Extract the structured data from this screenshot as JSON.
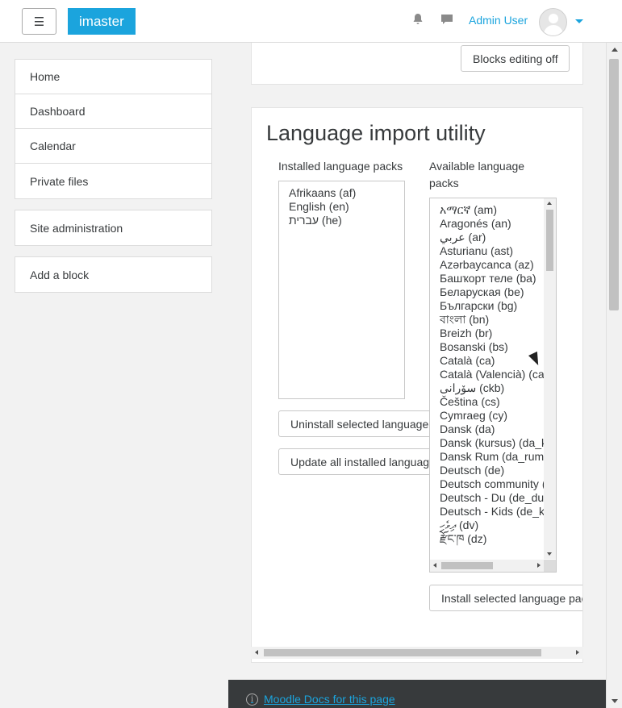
{
  "navbar": {
    "menu_icon": "☰",
    "brand": "imaster",
    "bell_icon": "bell-icon",
    "chat_icon": "chat-icon",
    "user_name": "Admin User"
  },
  "drawer": {
    "group1": [
      "Home",
      "Dashboard",
      "Calendar",
      "Private files"
    ],
    "site_admin": "Site administration",
    "add_block": "Add a block"
  },
  "main": {
    "blocks_editing_label": "Blocks editing off",
    "title": "Language import utility",
    "installed_label": "Installed language packs",
    "available_label": "Available language packs",
    "installed_packs": [
      "Afrikaans (af)",
      "English (en)",
      "עברית (he)"
    ],
    "uninstall_label": "Uninstall selected language pack(s)",
    "update_label": "Update all installed language packs",
    "available_packs": [
      "አማርኛ (am)",
      "Aragonés (an)",
      "عربي (ar)",
      "Asturianu (ast)",
      "Azərbaycanca (az)",
      "Башҡорт теле (ba)",
      "Беларуская (be)",
      "Български (bg)",
      "বাংলা (bn)",
      "Breizh (br)",
      "Bosanski (bs)",
      "Català (ca)",
      "Català (Valencià) (ca_valencia)",
      "سۆرانی (ckb)",
      "Čeština (cs)",
      "Cymraeg (cy)",
      "Dansk (da)",
      "Dansk (kursus) (da_kursus)",
      "Dansk Rum (da_rum)",
      "Deutsch (de)",
      "Deutsch community (de_comm)",
      "Deutsch - Du (de_du)",
      "Deutsch - Kids (de_kids)",
      "ދިވެހި (dv)",
      "རྫོང་ཁ (dz)"
    ],
    "install_label": "Install selected language pack(s)"
  },
  "footer": {
    "docs_link": "Moodle Docs for this page"
  }
}
